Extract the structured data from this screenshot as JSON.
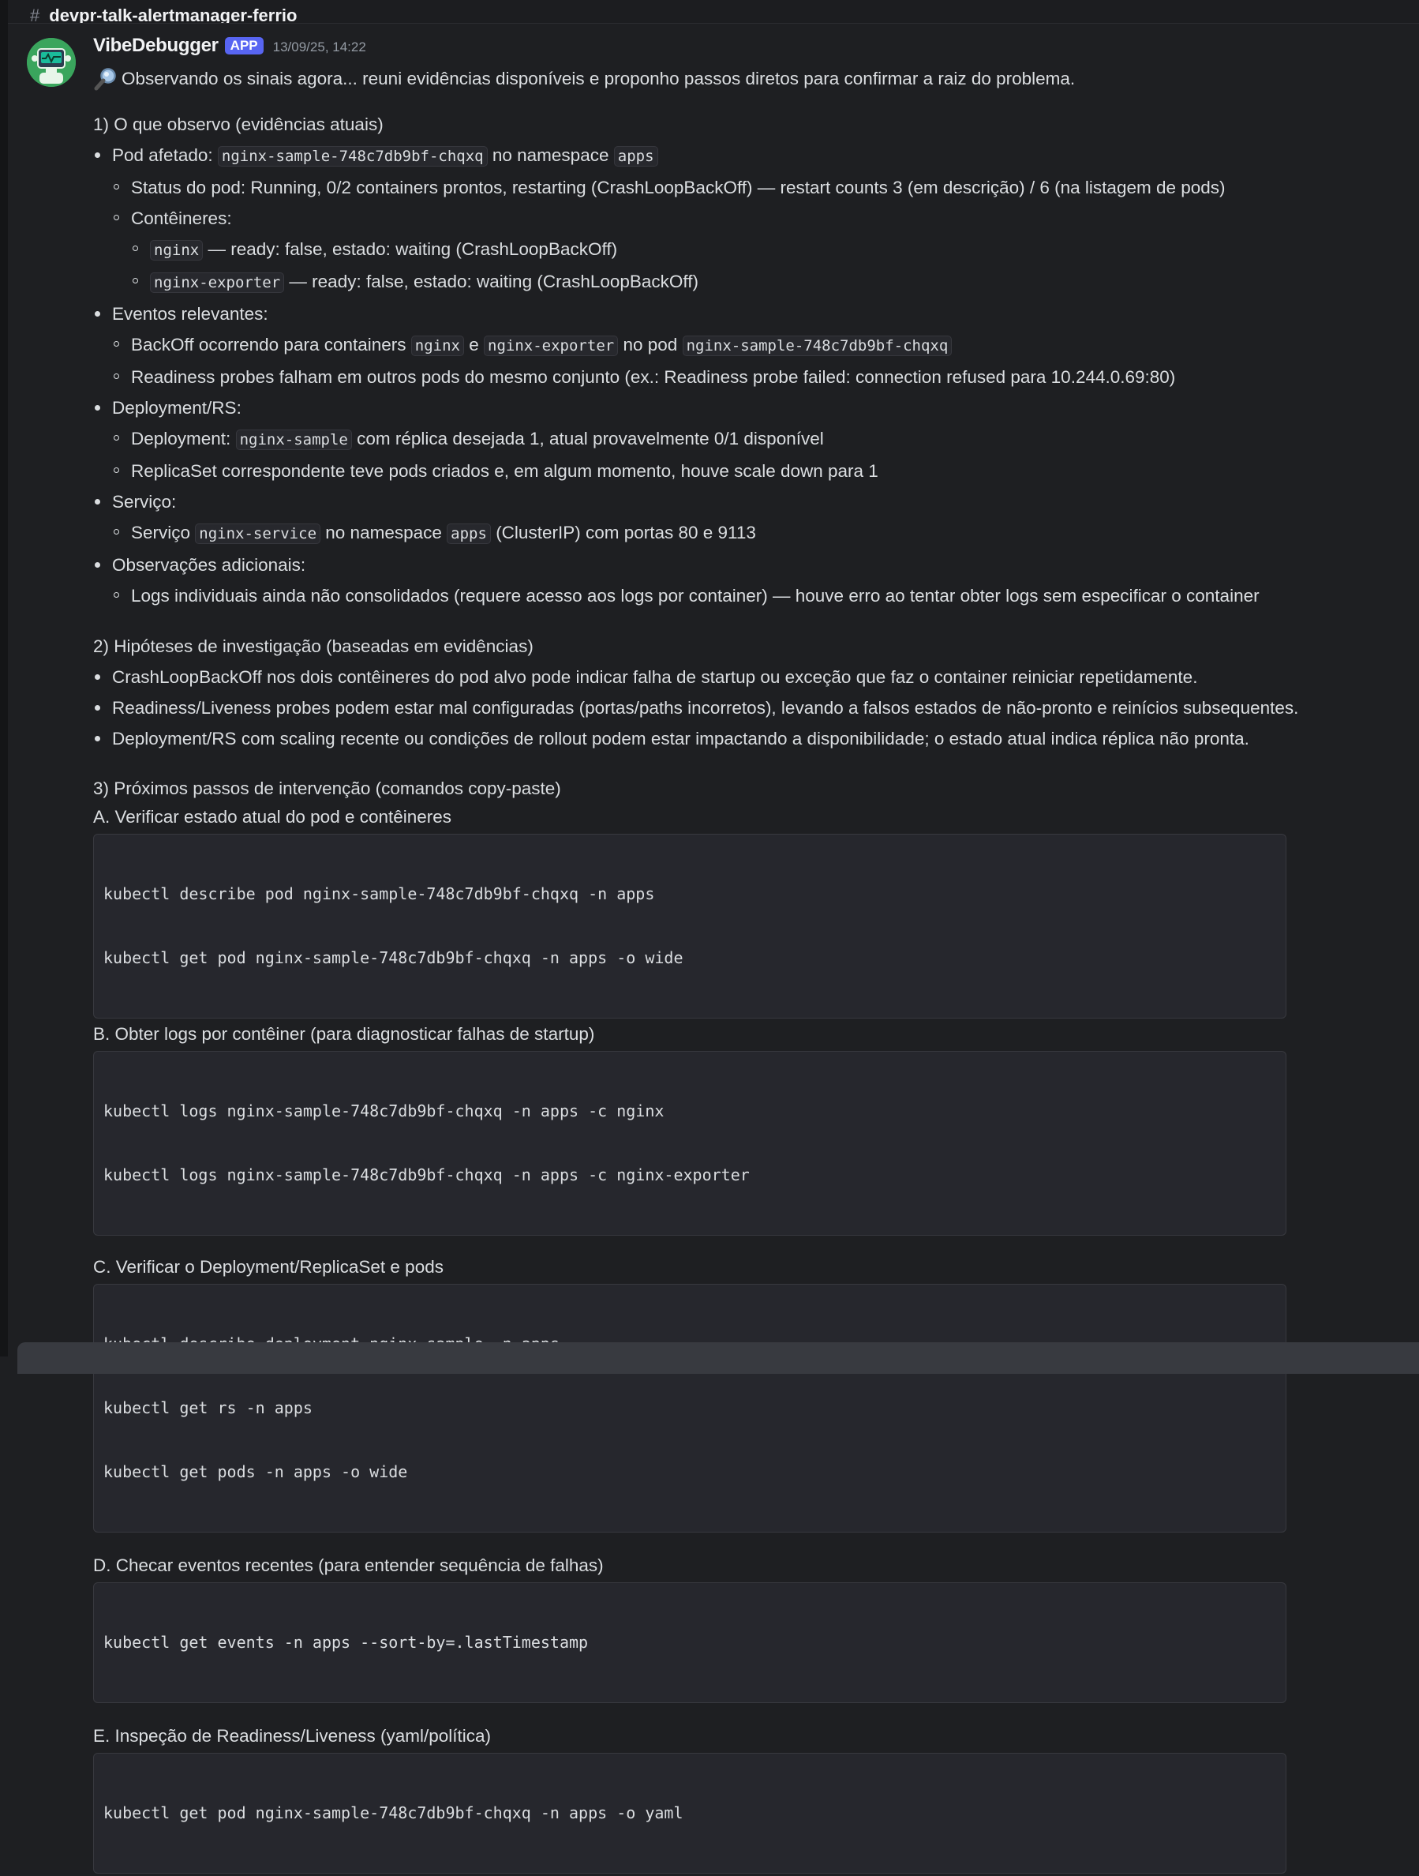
{
  "channel": {
    "name": "devpr-talk-alertmanager-ferrio"
  },
  "message": {
    "author": "VibeDebugger",
    "badge": "APP",
    "timestamp": "13/09/25, 14:22",
    "intro": "Observando os sinais agora... reuni evidências disponíveis e proponho passos diretos para confirmar a raiz do problema.",
    "s1": {
      "title": "1) O que observo (evidências atuais)",
      "pod_label": "Pod afetado:",
      "pod_name": "nginx-sample-748c7db9bf-chqxq",
      "pod_ns_text": "no namespace",
      "pod_ns": "apps",
      "status": "Status do pod: Running, 0/2 containers prontos, restarting (CrashLoopBackOff) — restart counts 3 (em descrição) / 6 (na listagem de pods)",
      "containers_label": "Contêineres:",
      "c1_name": "nginx",
      "c1_text": "— ready: false, estado: waiting (CrashLoopBackOff)",
      "c2_name": "nginx-exporter",
      "c2_text": "— ready: false, estado: waiting (CrashLoopBackOff)",
      "events_label": "Eventos relevantes:",
      "ev1_pre": "BackOff ocorrendo para containers",
      "ev1_c1": "nginx",
      "ev1_e": "e",
      "ev1_c2": "nginx-exporter",
      "ev1_mid": "no pod",
      "ev1_pod": "nginx-sample-748c7db9bf-chqxq",
      "ev2": "Readiness probes falham em outros pods do mesmo conjunto (ex.: Readiness probe failed: connection refused para 10.244.0.69:80)",
      "deploy_label": "Deployment/RS:",
      "dep1_pre": "Deployment:",
      "dep1_code": "nginx-sample",
      "dep1_post": "com réplica desejada 1, atual provavelmente 0/1 disponível",
      "dep2": "ReplicaSet correspondente teve pods criados e, em algum momento, houve scale down para 1",
      "svc_label": "Serviço:",
      "svc_pre": "Serviço",
      "svc_code": "nginx-service",
      "svc_mid": "no namespace",
      "svc_ns": "apps",
      "svc_post": "(ClusterIP) com portas 80 e 9113",
      "obs_label": "Observações adicionais:",
      "obs1": "Logs individuais ainda não consolidados (requere acesso aos logs por container) — houve erro ao tentar obter logs sem especificar o container"
    },
    "s2": {
      "title": "2) Hipóteses de investigação (baseadas em evidências)",
      "items": [
        "CrashLoopBackOff nos dois contêineres do pod alvo pode indicar falha de startup ou exceção que faz o container reiniciar repetidamente.",
        "Readiness/Liveness probes podem estar mal configuradas (portas/paths incorretos), levando a falsos estados de não-pronto e reinícios subsequentes.",
        "Deployment/RS com scaling recente ou condições de rollout podem estar impactando a disponibilidade; o estado atual indica réplica não pronta."
      ]
    },
    "s3": {
      "title": "3) Próximos passos de intervenção (comandos copy-paste)",
      "a_title": "A. Verificar estado atual do pod e contêineres",
      "a_code": [
        "kubectl describe pod nginx-sample-748c7db9bf-chqxq -n apps",
        "kubectl get pod nginx-sample-748c7db9bf-chqxq -n apps -o wide"
      ],
      "b_title": "B. Obter logs por contêiner (para diagnosticar falhas de startup)",
      "b_code": [
        "kubectl logs nginx-sample-748c7db9bf-chqxq -n apps -c nginx",
        "kubectl logs nginx-sample-748c7db9bf-chqxq -n apps -c nginx-exporter"
      ],
      "c_title": "C. Verificar o Deployment/ReplicaSet e pods",
      "c_code": [
        "kubectl describe deployment nginx-sample -n apps",
        "kubectl get rs -n apps",
        "kubectl get pods -n apps -o wide"
      ],
      "d_title": "D. Checar eventos recentes (para entender sequência de falhas)",
      "d_code": [
        "kubectl get events -n apps --sort-by=.lastTimestamp"
      ],
      "e_title": "E. Inspeção de Readiness/Liveness (yaml/política)",
      "e_code": [
        "kubectl get pod nginx-sample-748c7db9bf-chqxq -n apps -o yaml"
      ]
    }
  },
  "colors": {
    "badge": "#5865f2",
    "background": "#1e1f22",
    "code_bg": "#26272d",
    "avatar": "#3aa55d"
  }
}
